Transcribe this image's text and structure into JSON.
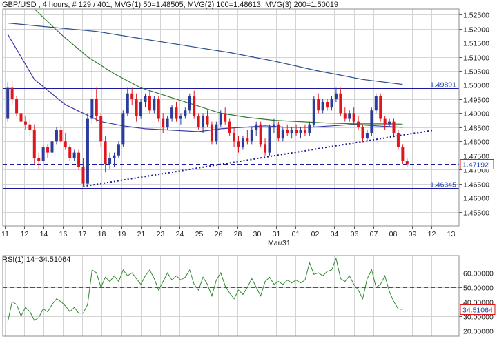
{
  "header": {
    "price_title": "GBP/USD , 4 hours, # 129 / 401, MVG(1) 50=1.48505, MVG(2) 100=1.48613, MVG(3) 200=1.50019",
    "rsi_title": "RSI(1) 14=34.51064"
  },
  "colors": {
    "background": "#ffffff",
    "grid": "#d4d4d4",
    "up_candle": "#2a3c9c",
    "down_candle": "#e0161d",
    "ma50": "#3a3aa6",
    "ma100": "#2f7a2f",
    "ma200": "#2a4f8c",
    "trendline": "#1a1a9a",
    "level_line": "#1a1a9a",
    "rsi_line": "#2f8a2f",
    "rsi_level": "#e01616"
  },
  "chart_data": [
    {
      "type": "candlestick",
      "title": "GBP/USD , 4 hours, # 129 / 401",
      "ylim": [
        1.45,
        1.527
      ],
      "y_ticks": [
        "1.52500",
        "1.52000",
        "1.51500",
        "1.51000",
        "1.50500",
        "1.50000",
        "1.49500",
        "1.49000",
        "1.48500",
        "1.48000",
        "1.47500",
        "1.47000",
        "1.46500",
        "1.46000",
        "1.45500"
      ],
      "x_ticks": [
        "11",
        "12",
        "14",
        "16",
        "17",
        "18",
        "19",
        "21",
        "23",
        "24",
        "25",
        "26",
        "28",
        "30",
        "31",
        "01",
        "02",
        "04",
        "06",
        "07",
        "08",
        "09",
        "12",
        "13"
      ],
      "x_sublabel": "Mar/31",
      "candles": [
        [
          1.488,
          1.501,
          1.487,
          1.499
        ],
        [
          1.499,
          1.5015,
          1.493,
          1.495
        ],
        [
          1.495,
          1.496,
          1.489,
          1.49
        ],
        [
          1.49,
          1.492,
          1.486,
          1.487
        ],
        [
          1.487,
          1.489,
          1.484,
          1.486
        ],
        [
          1.486,
          1.488,
          1.482,
          1.484
        ],
        [
          1.484,
          1.486,
          1.472,
          1.474
        ],
        [
          1.474,
          1.476,
          1.47,
          1.473
        ],
        [
          1.473,
          1.479,
          1.472,
          1.478
        ],
        [
          1.478,
          1.479,
          1.474,
          1.476
        ],
        [
          1.476,
          1.482,
          1.475,
          1.48
        ],
        [
          1.48,
          1.485,
          1.479,
          1.484
        ],
        [
          1.484,
          1.486,
          1.479,
          1.48
        ],
        [
          1.48,
          1.483,
          1.477,
          1.478
        ],
        [
          1.478,
          1.479,
          1.473,
          1.474
        ],
        [
          1.474,
          1.477,
          1.473,
          1.476
        ],
        [
          1.476,
          1.477,
          1.47,
          1.471
        ],
        [
          1.471,
          1.474,
          1.464,
          1.465
        ],
        [
          1.465,
          1.49,
          1.464,
          1.488
        ],
        [
          1.488,
          1.517,
          1.486,
          1.495
        ],
        [
          1.495,
          1.499,
          1.487,
          1.489
        ],
        [
          1.489,
          1.49,
          1.478,
          1.48
        ],
        [
          1.48,
          1.482,
          1.469,
          1.472
        ],
        [
          1.472,
          1.476,
          1.47,
          1.474
        ],
        [
          1.474,
          1.476,
          1.471,
          1.475
        ],
        [
          1.475,
          1.48,
          1.474,
          1.479
        ],
        [
          1.479,
          1.491,
          1.478,
          1.49
        ],
        [
          1.49,
          1.499,
          1.489,
          1.497
        ],
        [
          1.497,
          1.499,
          1.493,
          1.495
        ],
        [
          1.495,
          1.497,
          1.487,
          1.489
        ],
        [
          1.489,
          1.495,
          1.488,
          1.494
        ],
        [
          1.494,
          1.497,
          1.492,
          1.496
        ],
        [
          1.496,
          1.498,
          1.49,
          1.491
        ],
        [
          1.491,
          1.496,
          1.49,
          1.495
        ],
        [
          1.495,
          1.496,
          1.487,
          1.488
        ],
        [
          1.488,
          1.49,
          1.483,
          1.485
        ],
        [
          1.485,
          1.489,
          1.484,
          1.488
        ],
        [
          1.488,
          1.493,
          1.487,
          1.492
        ],
        [
          1.492,
          1.494,
          1.487,
          1.488
        ],
        [
          1.488,
          1.49,
          1.486,
          1.489
        ],
        [
          1.489,
          1.492,
          1.488,
          1.491
        ],
        [
          1.491,
          1.497,
          1.49,
          1.496
        ],
        [
          1.496,
          1.498,
          1.488,
          1.489
        ],
        [
          1.489,
          1.49,
          1.484,
          1.485
        ],
        [
          1.485,
          1.49,
          1.483,
          1.489
        ],
        [
          1.489,
          1.491,
          1.485,
          1.486
        ],
        [
          1.486,
          1.487,
          1.479,
          1.48
        ],
        [
          1.48,
          1.487,
          1.479,
          1.486
        ],
        [
          1.486,
          1.491,
          1.485,
          1.49
        ],
        [
          1.49,
          1.492,
          1.486,
          1.487
        ],
        [
          1.487,
          1.488,
          1.482,
          1.483
        ],
        [
          1.483,
          1.485,
          1.478,
          1.48
        ],
        [
          1.48,
          1.482,
          1.476,
          1.478
        ],
        [
          1.478,
          1.482,
          1.477,
          1.481
        ],
        [
          1.481,
          1.484,
          1.479,
          1.48
        ],
        [
          1.48,
          1.485,
          1.479,
          1.484
        ],
        [
          1.484,
          1.487,
          1.482,
          1.486
        ],
        [
          1.486,
          1.487,
          1.478,
          1.479
        ],
        [
          1.479,
          1.481,
          1.475,
          1.476
        ],
        [
          1.476,
          1.486,
          1.475,
          1.485
        ],
        [
          1.485,
          1.488,
          1.483,
          1.486
        ],
        [
          1.486,
          1.487,
          1.48,
          1.481
        ],
        [
          1.481,
          1.485,
          1.48,
          1.484
        ],
        [
          1.484,
          1.486,
          1.482,
          1.483
        ],
        [
          1.483,
          1.485,
          1.481,
          1.484
        ],
        [
          1.484,
          1.486,
          1.482,
          1.483
        ],
        [
          1.483,
          1.485,
          1.481,
          1.484
        ],
        [
          1.484,
          1.486,
          1.482,
          1.483
        ],
        [
          1.483,
          1.487,
          1.482,
          1.486
        ],
        [
          1.486,
          1.496,
          1.485,
          1.495
        ],
        [
          1.495,
          1.497,
          1.49,
          1.491
        ],
        [
          1.491,
          1.495,
          1.49,
          1.494
        ],
        [
          1.494,
          1.495,
          1.491,
          1.492
        ],
        [
          1.492,
          1.496,
          1.491,
          1.495
        ],
        [
          1.495,
          1.499,
          1.494,
          1.497
        ],
        [
          1.497,
          1.499,
          1.489,
          1.49
        ],
        [
          1.49,
          1.492,
          1.487,
          1.488
        ],
        [
          1.488,
          1.491,
          1.487,
          1.49
        ],
        [
          1.49,
          1.492,
          1.486,
          1.487
        ],
        [
          1.487,
          1.489,
          1.484,
          1.485
        ],
        [
          1.485,
          1.486,
          1.48,
          1.481
        ],
        [
          1.481,
          1.484,
          1.48,
          1.483
        ],
        [
          1.483,
          1.492,
          1.482,
          1.491
        ],
        [
          1.491,
          1.497,
          1.49,
          1.496
        ],
        [
          1.496,
          1.497,
          1.487,
          1.488
        ],
        [
          1.488,
          1.489,
          1.484,
          1.486
        ],
        [
          1.486,
          1.488,
          1.485,
          1.487
        ],
        [
          1.487,
          1.488,
          1.482,
          1.483
        ],
        [
          1.483,
          1.484,
          1.477,
          1.478
        ],
        [
          1.478,
          1.479,
          1.472,
          1.473
        ],
        [
          1.473,
          1.474,
          1.471,
          1.4719
        ]
      ],
      "moving_averages": [
        {
          "name": "MVG(1) 50",
          "value": "1.48505",
          "points": [
            [
              0,
              1.518
            ],
            [
              6,
              1.502
            ],
            [
              13,
              1.493
            ],
            [
              17,
              1.49
            ],
            [
              21,
              1.487
            ],
            [
              26,
              1.4855
            ],
            [
              31,
              1.4845
            ],
            [
              37,
              1.484
            ],
            [
              43,
              1.4835
            ],
            [
              48,
              1.4845
            ],
            [
              53,
              1.485
            ],
            [
              58,
              1.4855
            ],
            [
              63,
              1.485
            ],
            [
              68,
              1.485
            ],
            [
              73,
              1.4855
            ],
            [
              78,
              1.486
            ],
            [
              83,
              1.4855
            ],
            [
              89,
              1.485
            ]
          ]
        },
        {
          "name": "MVG(2) 100",
          "value": "1.48613",
          "points": [
            [
              6,
              1.527
            ],
            [
              12,
              1.518
            ],
            [
              18,
              1.51
            ],
            [
              24,
              1.504
            ],
            [
              30,
              1.499
            ],
            [
              36,
              1.496
            ],
            [
              42,
              1.493
            ],
            [
              48,
              1.49
            ],
            [
              54,
              1.4885
            ],
            [
              60,
              1.4875
            ],
            [
              66,
              1.487
            ],
            [
              72,
              1.4865
            ],
            [
              78,
              1.4862
            ],
            [
              84,
              1.4862
            ],
            [
              89,
              1.4861
            ]
          ]
        },
        {
          "name": "MVG(3) 200",
          "value": "1.50019",
          "points": [
            [
              0,
              1.522
            ],
            [
              10,
              1.5205
            ],
            [
              20,
              1.519
            ],
            [
              30,
              1.5165
            ],
            [
              40,
              1.514
            ],
            [
              50,
              1.5115
            ],
            [
              60,
              1.5085
            ],
            [
              70,
              1.505
            ],
            [
              80,
              1.502
            ],
            [
              89,
              1.5002
            ]
          ]
        }
      ],
      "horizontal_levels": [
        {
          "value": 1.49891,
          "label": "1.49891",
          "style": "solid"
        },
        {
          "value": 1.46345,
          "label": "1.46345",
          "style": "solid"
        },
        {
          "value": 1.47192,
          "label": "1.47192",
          "style": "dashed",
          "current": true
        }
      ],
      "trendline": {
        "start": [
          17,
          1.464
        ],
        "end": [
          96,
          1.484
        ],
        "style": "dotted"
      }
    },
    {
      "type": "line",
      "title": "RSI(1) 14=34.51064",
      "series_name": "RSI(1) 14",
      "ylim": [
        16,
        72
      ],
      "y_ticks": [
        "60.00000",
        "50.00000",
        "40.00000",
        "30.00000",
        "20.00000"
      ],
      "reference_level": 50,
      "current_value": "34.51064",
      "values": [
        26,
        40,
        38,
        30,
        36,
        33,
        27,
        29,
        35,
        33,
        38,
        42,
        40,
        37,
        33,
        36,
        32,
        32,
        38,
        62,
        60,
        50,
        57,
        54,
        58,
        54,
        62,
        58,
        60,
        56,
        52,
        58,
        62,
        56,
        48,
        54,
        60,
        55,
        58,
        55,
        57,
        62,
        52,
        48,
        57,
        52,
        44,
        55,
        60,
        51,
        46,
        42,
        48,
        45,
        50,
        56,
        50,
        44,
        54,
        57,
        52,
        54,
        52,
        55,
        53,
        55,
        53,
        55,
        67,
        59,
        60,
        58,
        61,
        62,
        70,
        56,
        54,
        58,
        52,
        48,
        42,
        56,
        62,
        50,
        52,
        58,
        47,
        40,
        35,
        34.5
      ]
    }
  ]
}
